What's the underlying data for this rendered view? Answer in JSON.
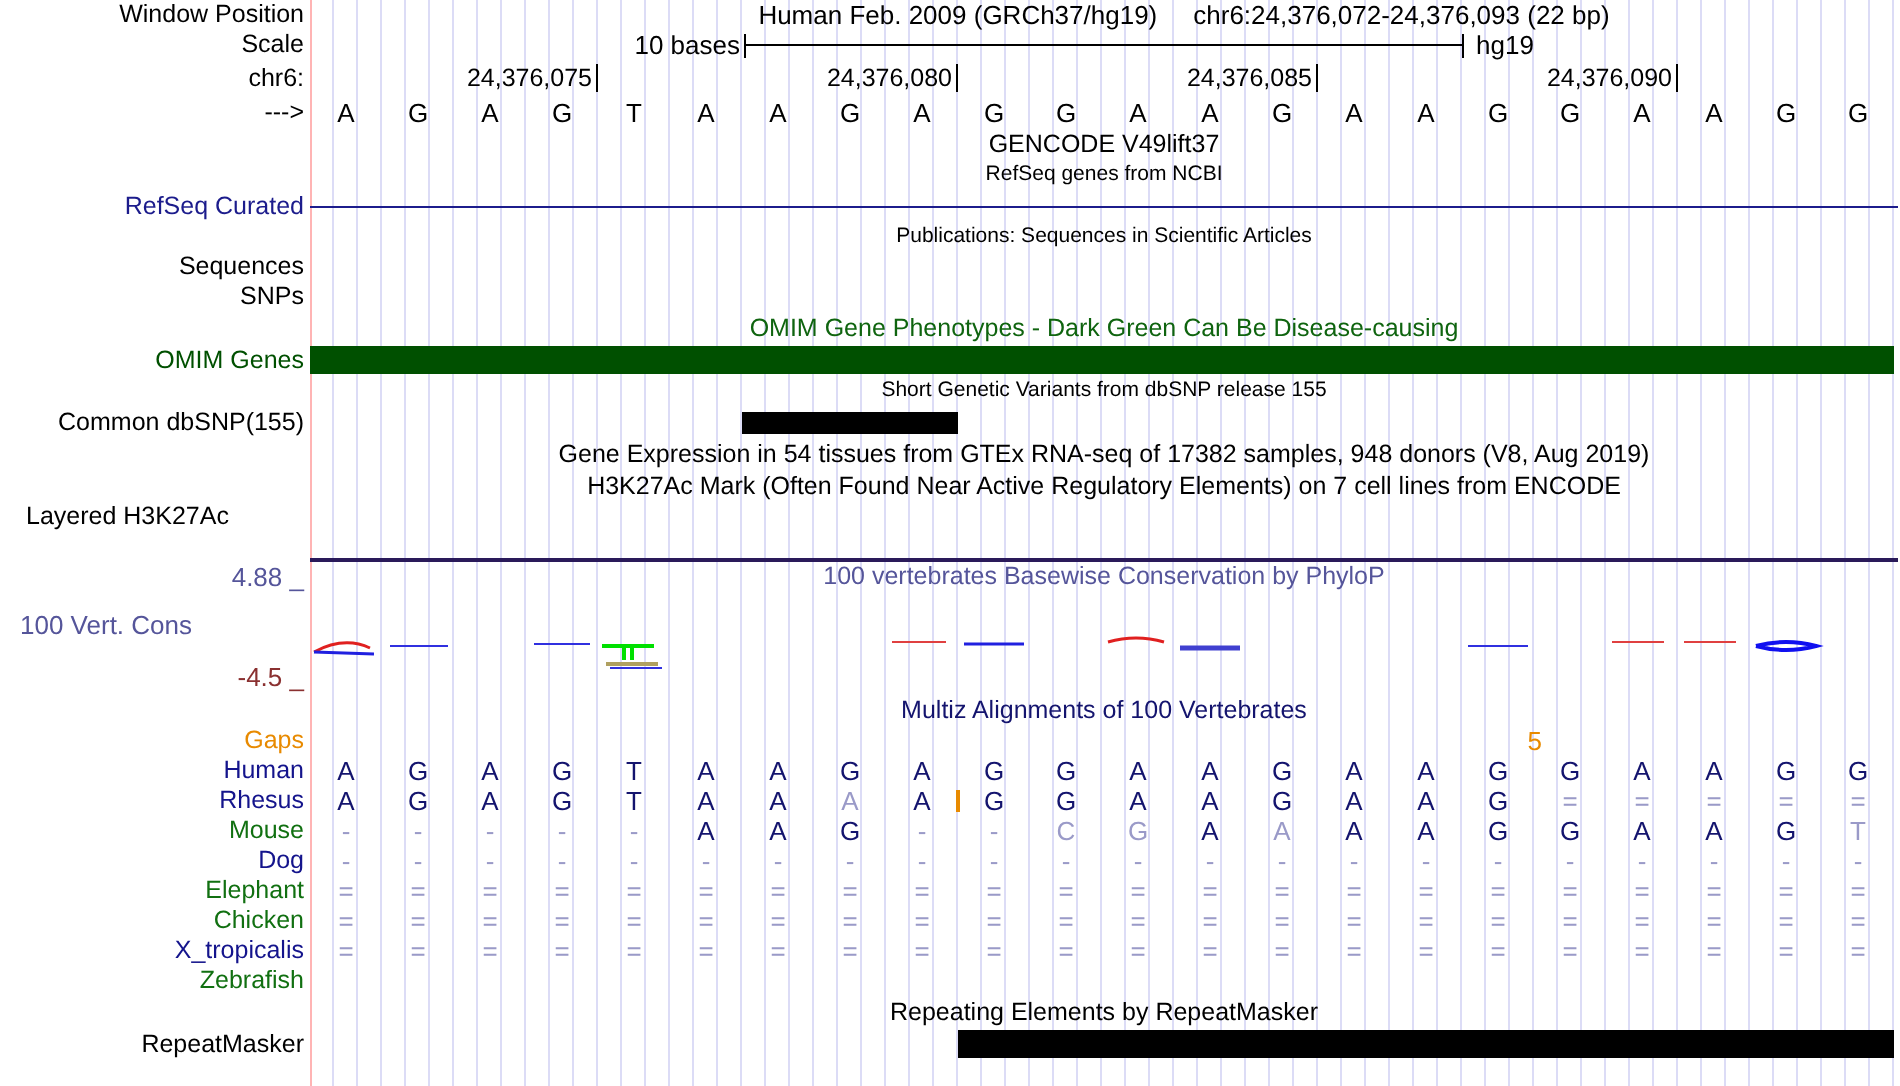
{
  "header": {
    "label": "Window Position",
    "assembly": "Human Feb. 2009 (GRCh37/hg19)",
    "position": "chr6:24,376,072-24,376,093 (22 bp)"
  },
  "scale": {
    "label": "Scale",
    "span": "10 bases",
    "assembly": "hg19"
  },
  "ruler": {
    "label": "chr6:",
    "ticks": [
      "24,376,075",
      "24,376,080",
      "24,376,085",
      "24,376,090"
    ]
  },
  "sequence": {
    "label": "--->",
    "bases": [
      "A",
      "G",
      "A",
      "G",
      "T",
      "A",
      "A",
      "G",
      "A",
      "G",
      "G",
      "A",
      "A",
      "G",
      "A",
      "A",
      "G",
      "G",
      "A",
      "A",
      "G",
      "G"
    ]
  },
  "tracks": [
    {
      "kind": "title",
      "title": "GENCODE V49lift37",
      "color": "#000000"
    },
    {
      "kind": "note",
      "title": "RefSeq genes from NCBI"
    },
    {
      "kind": "line",
      "label": "RefSeq Curated",
      "color": "#1c1c8c"
    },
    {
      "kind": "note",
      "title": "Publications: Sequences in Scientific Articles"
    },
    {
      "kind": "label",
      "label": "Sequences"
    },
    {
      "kind": "label",
      "label": "SNPs"
    },
    {
      "kind": "title",
      "title": "OMIM Gene Phenotypes - Dark Green Can Be Disease-causing",
      "color": "#0f640f"
    },
    {
      "kind": "bar",
      "label": "OMIM Genes",
      "color": "#005000"
    },
    {
      "kind": "note",
      "title": "Short Genetic Variants from dbSNP release 155"
    },
    {
      "kind": "bar",
      "label": "Common dbSNP(155)",
      "color": "#000000"
    },
    {
      "kind": "title",
      "title": "Gene Expression in 54 tissues from GTEx RNA-seq of 17382 samples, 948 donors (V8, Aug 2019)",
      "color": "#000000"
    },
    {
      "kind": "title",
      "title": "H3K27Ac Mark (Often Found Near Active Regulatory Elements) on 7 cell lines from ENCODE",
      "color": "#000000"
    },
    {
      "kind": "side-label",
      "label": "Layered H3K27Ac"
    },
    {
      "kind": "wiggle",
      "label": "100 Vert. Cons",
      "title": "100 vertebrates Basewise Conservation by PhyloP",
      "max": "4.88 _",
      "min": "-4.5 _",
      "color": "#55559a"
    },
    {
      "kind": "alignment",
      "title": "Multiz Alignments of 100 Vertebrates",
      "color": "#14146e",
      "gaps": {
        "label": "Gaps",
        "counts": [
          "5"
        ],
        "insert_after": [
          false,
          false,
          false,
          false,
          false,
          false,
          false,
          false,
          false,
          false,
          false,
          false,
          false,
          false,
          false,
          false,
          true,
          false,
          false,
          false,
          false,
          false
        ]
      },
      "species": [
        {
          "name": "Human",
          "color": "#14148c",
          "bases": [
            "A",
            "G",
            "A",
            "G",
            "T",
            "A",
            "A",
            "G",
            "A",
            "G",
            "G",
            "A",
            "A",
            "G",
            "A",
            "A",
            "G",
            "G",
            "A",
            "A",
            "G",
            "G"
          ],
          "faded": [
            false,
            false,
            false,
            false,
            false,
            false,
            false,
            false,
            false,
            false,
            false,
            false,
            false,
            false,
            false,
            false,
            false,
            false,
            false,
            false,
            false,
            false
          ],
          "insert_after": [
            false,
            false,
            false,
            false,
            false,
            false,
            false,
            false,
            false,
            false,
            false,
            false,
            false,
            false,
            false,
            false,
            false,
            false,
            false,
            false,
            false,
            false
          ]
        },
        {
          "name": "Rhesus",
          "color": "#14148c",
          "bases": [
            "A",
            "G",
            "A",
            "G",
            "T",
            "A",
            "A",
            "A",
            "A",
            "G",
            "G",
            "A",
            "A",
            "G",
            "A",
            "A",
            "G",
            "=",
            "=",
            "=",
            "=",
            "="
          ],
          "faded": [
            false,
            false,
            false,
            false,
            false,
            false,
            false,
            true,
            false,
            false,
            false,
            false,
            false,
            false,
            false,
            false,
            false,
            true,
            true,
            true,
            true,
            true
          ],
          "insert_after": [
            false,
            false,
            false,
            false,
            false,
            false,
            false,
            false,
            true,
            false,
            false,
            false,
            false,
            false,
            false,
            false,
            false,
            false,
            false,
            false,
            false,
            false
          ]
        },
        {
          "name": "Mouse",
          "color": "#117011",
          "bases": [
            "-",
            "-",
            "-",
            "-",
            "-",
            "A",
            "A",
            "G",
            "-",
            "-",
            "C",
            "G",
            "A",
            "A",
            "A",
            "A",
            "G",
            "G",
            "A",
            "A",
            "G",
            "T"
          ],
          "faded": [
            true,
            true,
            true,
            true,
            true,
            false,
            false,
            false,
            true,
            true,
            true,
            true,
            false,
            true,
            false,
            false,
            false,
            false,
            false,
            false,
            false,
            true
          ],
          "insert_after": [
            false,
            false,
            false,
            false,
            false,
            false,
            false,
            false,
            false,
            false,
            false,
            false,
            false,
            false,
            false,
            false,
            false,
            false,
            false,
            false,
            false,
            false
          ]
        },
        {
          "name": "Dog",
          "color": "#14148c",
          "bases": [
            "-",
            "-",
            "-",
            "-",
            "-",
            "-",
            "-",
            "-",
            "-",
            "-",
            "-",
            "-",
            "-",
            "-",
            "-",
            "-",
            "-",
            "-",
            "-",
            "-",
            "-",
            "-"
          ],
          "faded": [
            true,
            true,
            true,
            true,
            true,
            true,
            true,
            true,
            true,
            true,
            true,
            true,
            true,
            true,
            true,
            true,
            true,
            true,
            true,
            true,
            true,
            true
          ],
          "insert_after": [
            false,
            false,
            false,
            false,
            false,
            false,
            false,
            false,
            false,
            false,
            false,
            false,
            false,
            false,
            false,
            false,
            false,
            false,
            false,
            false,
            false,
            false
          ]
        },
        {
          "name": "Elephant",
          "color": "#117011",
          "bases": [
            "=",
            "=",
            "=",
            "=",
            "=",
            "=",
            "=",
            "=",
            "=",
            "=",
            "=",
            "=",
            "=",
            "=",
            "=",
            "=",
            "=",
            "=",
            "=",
            "=",
            "=",
            "="
          ],
          "faded": [
            true,
            true,
            true,
            true,
            true,
            true,
            true,
            true,
            true,
            true,
            true,
            true,
            true,
            true,
            true,
            true,
            true,
            true,
            true,
            true,
            true,
            true
          ],
          "insert_after": [
            false,
            false,
            false,
            false,
            false,
            false,
            false,
            false,
            false,
            false,
            false,
            false,
            false,
            false,
            false,
            false,
            false,
            false,
            false,
            false,
            false,
            false
          ]
        },
        {
          "name": "Chicken",
          "color": "#117011",
          "bases": [
            "=",
            "=",
            "=",
            "=",
            "=",
            "=",
            "=",
            "=",
            "=",
            "=",
            "=",
            "=",
            "=",
            "=",
            "=",
            "=",
            "=",
            "=",
            "=",
            "=",
            "=",
            "="
          ],
          "faded": [
            true,
            true,
            true,
            true,
            true,
            true,
            true,
            true,
            true,
            true,
            true,
            true,
            true,
            true,
            true,
            true,
            true,
            true,
            true,
            true,
            true,
            true
          ],
          "insert_after": [
            false,
            false,
            false,
            false,
            false,
            false,
            false,
            false,
            false,
            false,
            false,
            false,
            false,
            false,
            false,
            false,
            false,
            false,
            false,
            false,
            false,
            false
          ]
        },
        {
          "name": "X_tropicalis",
          "color": "#14148c",
          "bases": [
            "=",
            "=",
            "=",
            "=",
            "=",
            "=",
            "=",
            "=",
            "=",
            "=",
            "=",
            "=",
            "=",
            "=",
            "=",
            "=",
            "=",
            "=",
            "=",
            "=",
            "=",
            "="
          ],
          "faded": [
            true,
            true,
            true,
            true,
            true,
            true,
            true,
            true,
            true,
            true,
            true,
            true,
            true,
            true,
            true,
            true,
            true,
            true,
            true,
            true,
            true,
            true
          ],
          "insert_after": [
            false,
            false,
            false,
            false,
            false,
            false,
            false,
            false,
            false,
            false,
            false,
            false,
            false,
            false,
            false,
            false,
            false,
            false,
            false,
            false,
            false,
            false
          ]
        },
        {
          "name": "Zebrafish",
          "color": "#117011"
        }
      ]
    },
    {
      "kind": "title",
      "title": "Repeating Elements by RepeatMasker",
      "color": "#000000"
    },
    {
      "kind": "bar",
      "label": "RepeatMasker",
      "color": "#000000"
    }
  ]
}
